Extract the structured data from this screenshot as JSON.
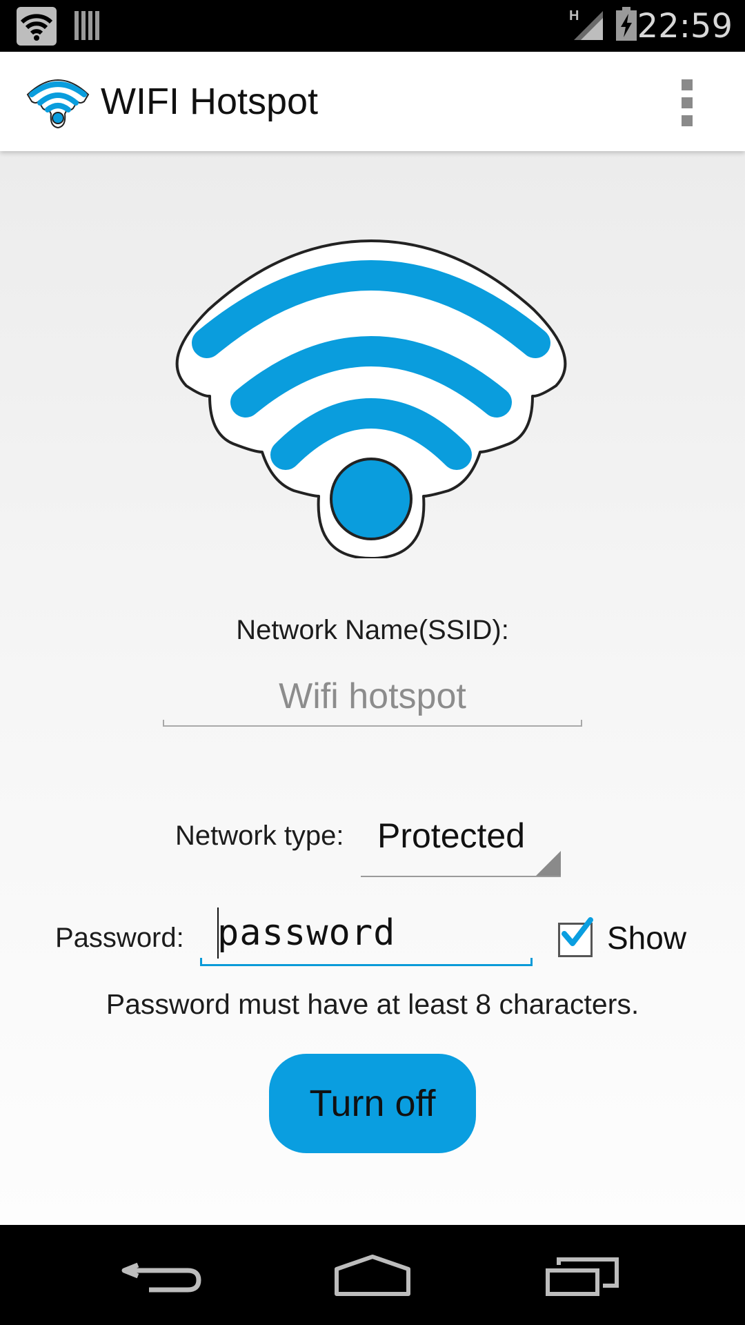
{
  "status_bar": {
    "time": "22:59",
    "network_indicator": "H",
    "icons": [
      "wifi-hotspot-icon",
      "sim-bars-icon",
      "signal-icon",
      "battery-charging-icon"
    ]
  },
  "action_bar": {
    "title": "WIFI Hotspot",
    "app_icon": "wifi-icon",
    "overflow_icon": "overflow-menu-icon"
  },
  "form": {
    "ssid_label": "Network Name(SSID):",
    "ssid_value": "Wifi hotspot",
    "type_label": "Network type:",
    "type_value": "Protected",
    "password_label": "Password:",
    "password_value": "password",
    "show_label": "Show",
    "show_checked": true,
    "hint": "Password must have at least 8 characters.",
    "toggle_button": "Turn off"
  },
  "colors": {
    "accent": "#0a9ee0",
    "wifi_blue": "#0a9ddd"
  },
  "nav_bar": {
    "buttons": [
      "back-icon",
      "home-icon",
      "recents-icon"
    ]
  }
}
